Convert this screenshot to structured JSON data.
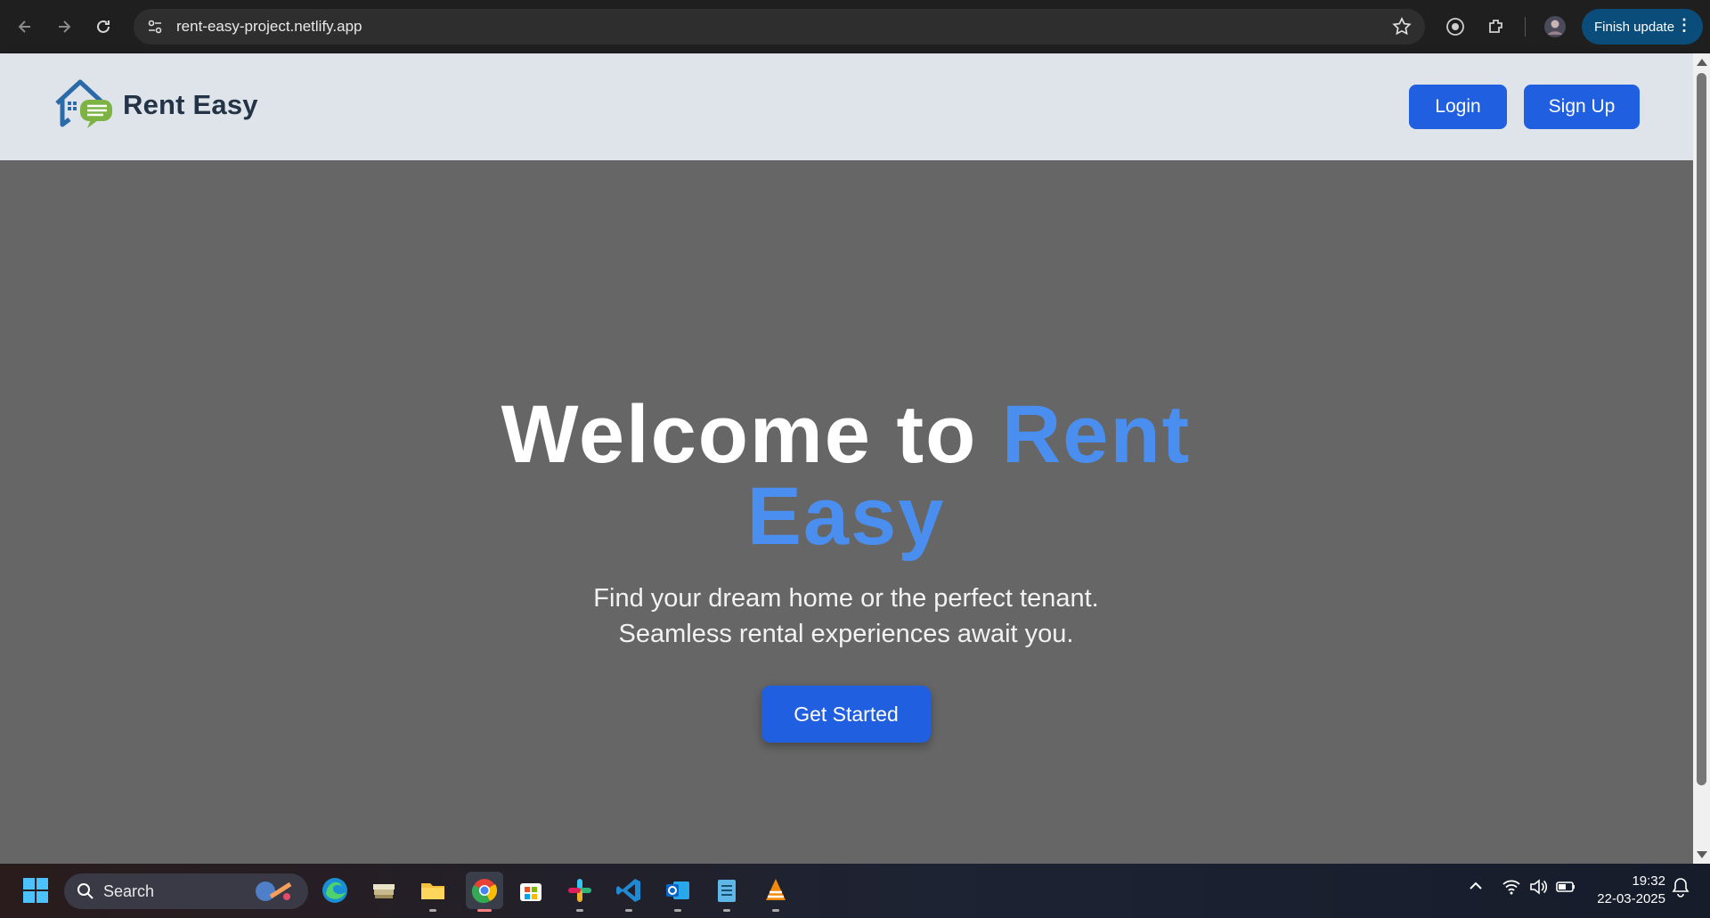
{
  "browser": {
    "url": "rent-easy-project.netlify.app",
    "finish_update_label": "Finish update"
  },
  "header": {
    "brand": "Rent Easy",
    "login_label": "Login",
    "signup_label": "Sign Up"
  },
  "hero": {
    "title_part1": "Welcome to ",
    "title_accent": "Rent Easy",
    "subtitle_line1": "Find your dream home or the perfect tenant.",
    "subtitle_line2": "Seamless rental experiences await you.",
    "cta_label": "Get Started"
  },
  "taskbar": {
    "search_label": "Search",
    "time": "19:32",
    "date": "22-03-2025"
  },
  "colors": {
    "accent": "#4a8ff0",
    "button": "#1f5fe0",
    "header_bg": "#dfe3ea",
    "hero_bg": "#666666"
  }
}
